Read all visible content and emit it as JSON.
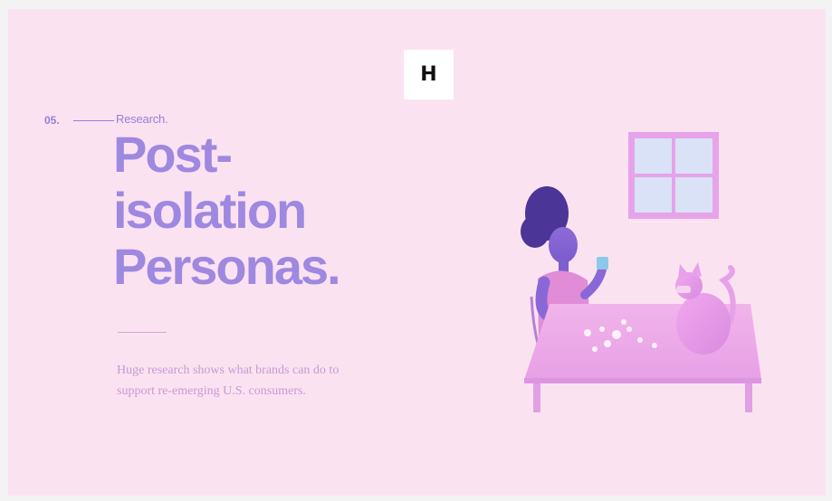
{
  "logo": {
    "letter": "H"
  },
  "section": {
    "number": "05.",
    "label": "Research."
  },
  "headline": {
    "lines": [
      "Post-",
      "isolation",
      "Personas."
    ]
  },
  "description": "Huge research shows what brands can do to support re-emerging U.S. consumers.",
  "colors": {
    "background": "#fbe2f1",
    "headline": "#9e88e0",
    "body_text": "#c898d2",
    "accent": "#9580d6"
  },
  "illustration": {
    "subject": "woman-with-cat-at-table-illustration"
  }
}
